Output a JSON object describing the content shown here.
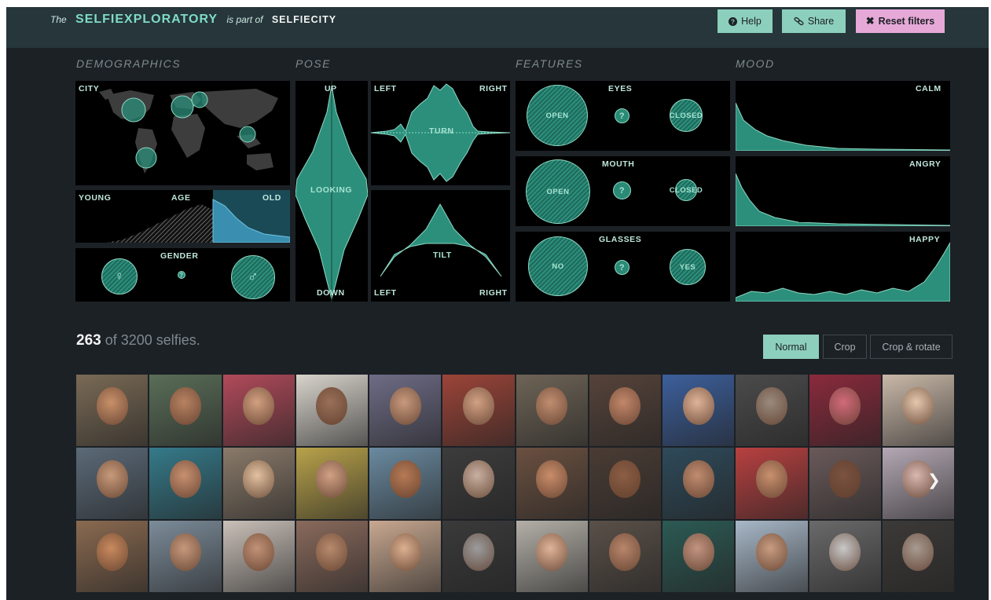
{
  "header": {
    "the": "The",
    "brand": "SELFIEXPLORATORY",
    "is_part_of": "is part of",
    "parent": "SELFIECITY",
    "help": "Help",
    "share": "Share",
    "reset": "Reset filters"
  },
  "sections": {
    "demographics": "DEMOGRAPHICS",
    "pose": "POSE",
    "features": "FEATURES",
    "mood": "MOOD"
  },
  "demographics": {
    "city": "CITY",
    "age_young": "YOUNG",
    "age": "AGE",
    "age_old": "OLD",
    "gender": "GENDER",
    "female_symbol": "♀",
    "unknown_symbol": "?",
    "male_symbol": "♂"
  },
  "pose": {
    "up": "UP",
    "looking": "LOOKING",
    "down": "DOWN",
    "left": "LEFT",
    "right": "RIGHT",
    "turn": "TURN",
    "tilt": "TILT"
  },
  "features": {
    "eyes": {
      "title": "EYES",
      "a": "OPEN",
      "q": "?",
      "b": "CLOSED"
    },
    "mouth": {
      "title": "MOUTH",
      "a": "OPEN",
      "q": "?",
      "b": "CLOSED"
    },
    "glasses": {
      "title": "GLASSES",
      "a": "NO",
      "q": "?",
      "b": "YES"
    }
  },
  "mood": {
    "calm": "CALM",
    "angry": "ANGRY",
    "happy": "HAPPY"
  },
  "results": {
    "count": "263",
    "of_text": "of 3200 selfies."
  },
  "view_modes": {
    "normal": "Normal",
    "crop": "Crop",
    "crop_rotate": "Crop & rotate",
    "active": "Normal"
  },
  "colors": {
    "accent": "#8dcfbd",
    "reset": "#e6a9d7",
    "background": "#1c2126",
    "chart": "#2c8f7b"
  },
  "icons": {
    "help": "question-circle-icon",
    "share": "link-icon",
    "reset": "close-icon",
    "next": "chevron-right-icon"
  },
  "thumbnails": [
    {
      "bg": "#7a6a55",
      "skin": "#c8906a"
    },
    {
      "bg": "#5a6e58",
      "skin": "#b88262"
    },
    {
      "bg": "#b14a5a",
      "skin": "#d2a080"
    },
    {
      "bg": "#d8d4cc",
      "skin": "#9a7058"
    },
    {
      "bg": "#6e6c86",
      "skin": "#c79a7d"
    },
    {
      "bg": "#9c4438",
      "skin": "#d2a184"
    },
    {
      "bg": "#6e6456",
      "skin": "#c08e70"
    },
    {
      "bg": "#56433a",
      "skin": "#c2876a"
    },
    {
      "bg": "#3c5f9c",
      "skin": "#e0b498"
    },
    {
      "bg": "#4b4b4b",
      "skin": "#9a8a7c"
    },
    {
      "bg": "#8a2a3c",
      "skin": "#d26a7a"
    },
    {
      "bg": "#c9b8a8",
      "skin": "#e4c8ad"
    },
    {
      "bg": "#5b6a78",
      "skin": "#c79a7a"
    },
    {
      "bg": "#357a8a",
      "skin": "#c89070"
    },
    {
      "bg": "#8a7a6a",
      "skin": "#e2c2a0"
    },
    {
      "bg": "#b8a24a",
      "skin": "#d1a184"
    },
    {
      "bg": "#6a8aa0",
      "skin": "#b67a55"
    },
    {
      "bg": "#3c3c3c",
      "skin": "#c8b0a0"
    },
    {
      "bg": "#6a5040",
      "skin": "#c98d6a"
    },
    {
      "bg": "#4a3c34",
      "skin": "#8c5e44"
    },
    {
      "bg": "#2e4a5a",
      "skin": "#c08c70"
    },
    {
      "bg": "#b84040",
      "skin": "#c9906e"
    },
    {
      "bg": "#6a5a5a",
      "skin": "#7a5240"
    },
    {
      "bg": "#b4a8b4",
      "skin": "#d8b8b0"
    },
    {
      "bg": "#8a6a50",
      "skin": "#c88a5e"
    },
    {
      "bg": "#7c8c9a",
      "skin": "#c6987c"
    },
    {
      "bg": "#c9c0b8",
      "skin": "#c29276"
    },
    {
      "bg": "#8a6a5c",
      "skin": "#b88a6c"
    },
    {
      "bg": "#c8a890",
      "skin": "#dcb090"
    },
    {
      "bg": "#3a3a3a",
      "skin": "#9c9c9c"
    },
    {
      "bg": "#b4b0a8",
      "skin": "#e0b498"
    },
    {
      "bg": "#5a5048",
      "skin": "#b8866a"
    },
    {
      "bg": "#2c5a54",
      "skin": "#c29480"
    },
    {
      "bg": "#a8b8c8",
      "skin": "#c89c80"
    },
    {
      "bg": "#6a6a6a",
      "skin": "#c8c8c8"
    },
    {
      "bg": "#3c3a38",
      "skin": "#a89a90"
    }
  ]
}
